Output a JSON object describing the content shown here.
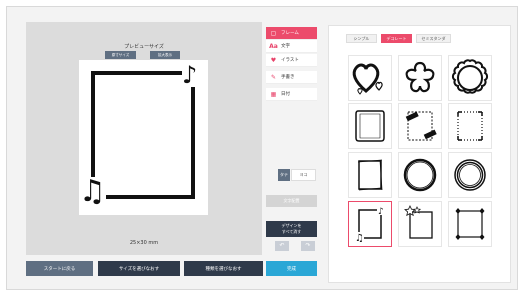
{
  "preview": {
    "title": "プレビューサイズ",
    "btn_left": "原寸サイズ",
    "btn_right": "拡大表示",
    "size_text": "25×30 mm"
  },
  "menu": {
    "items": [
      {
        "label": "フレーム",
        "icon": "frame-icon",
        "glyph": "▢"
      },
      {
        "label": "文字",
        "icon": "text-icon",
        "glyph": "Aa"
      },
      {
        "label": "イラスト",
        "icon": "heart-icon",
        "glyph": "♥"
      },
      {
        "label": "手書き",
        "icon": "pen-icon",
        "glyph": "✎"
      },
      {
        "label": "日付",
        "icon": "calendar-icon",
        "glyph": "▦"
      }
    ]
  },
  "orientation": {
    "vertical": "タテ",
    "horizontal": "ヨコ"
  },
  "side_buttons": {
    "disabled": "文字配置",
    "reset_line1": "デザインを",
    "reset_line2": "すべて消す",
    "undo": "↶",
    "redo": "↷"
  },
  "tabs": [
    "シンプル",
    "デコレート",
    "セミスタンダ"
  ],
  "bottom": {
    "save": "スタートに戻る",
    "size": "サイズを選びなおす",
    "type": "種類を選びなおす",
    "done": "完成"
  },
  "colors": {
    "accent": "#ec4b6b",
    "dark_button": "#2f3a4a",
    "blue_button": "#2aa7d6"
  }
}
